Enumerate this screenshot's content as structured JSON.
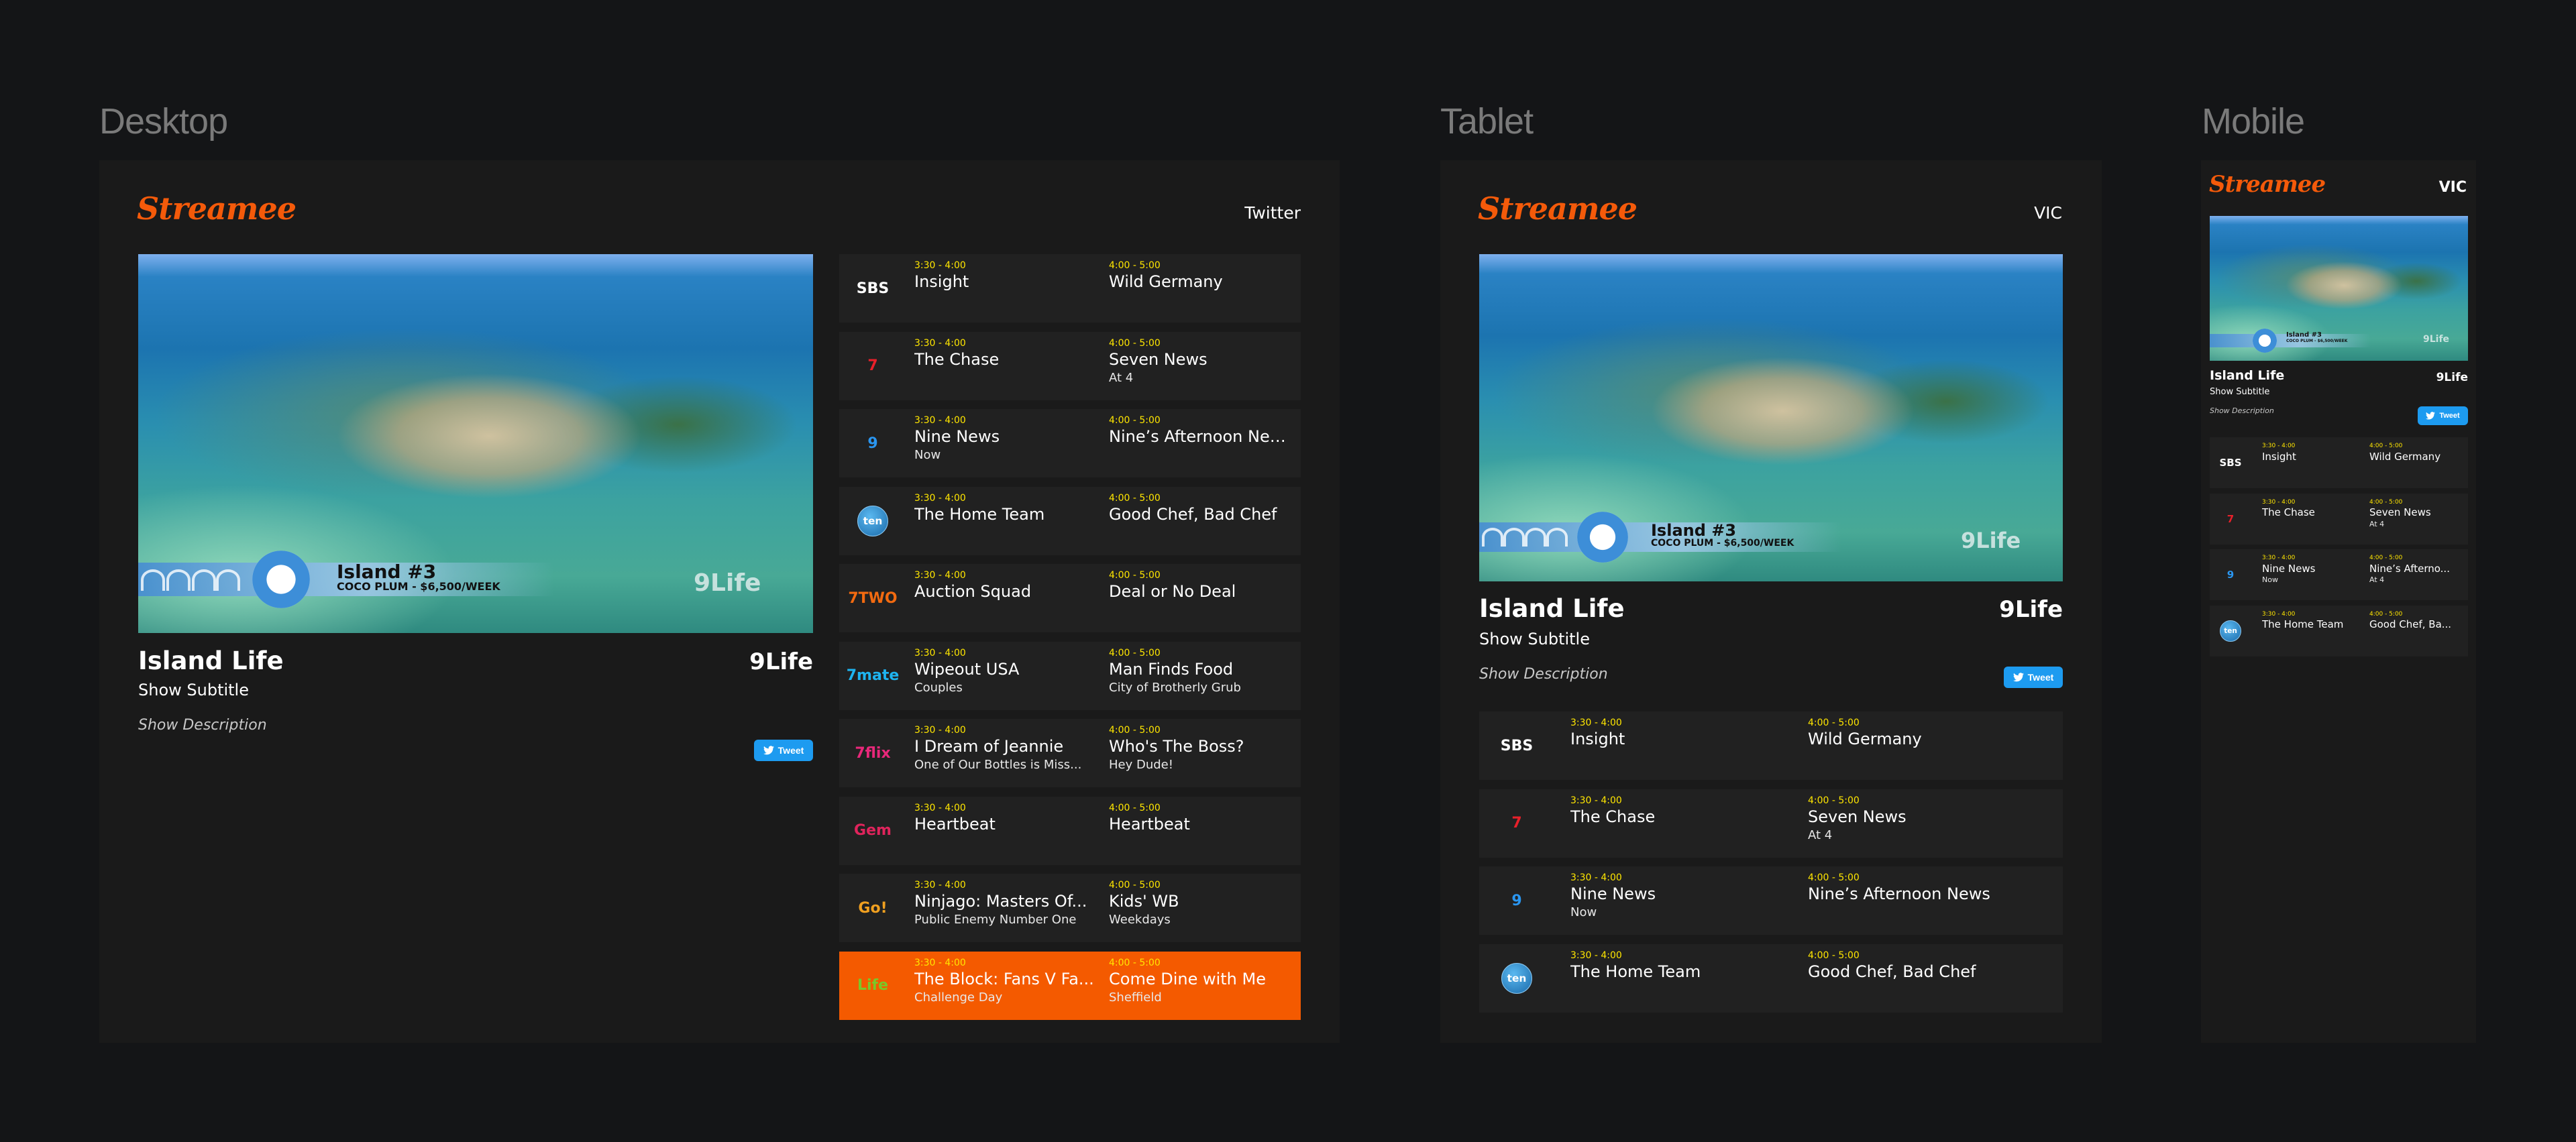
{
  "labels": {
    "desktop": "Desktop",
    "tablet": "Tablet",
    "mobile": "Mobile"
  },
  "brand": {
    "name": "Streamee",
    "accent": "#f45a0a"
  },
  "desktop": {
    "region": "Twitter"
  },
  "tablet": {
    "region": "VIC"
  },
  "mobile": {
    "region": "VIC"
  },
  "show": {
    "title": "Island Life",
    "subtitle": "Show Subtitle",
    "description": "Show Description",
    "channel_logo": "9Life",
    "tweet_label": "Tweet",
    "video_overlay": {
      "title": "Island #3",
      "subtitle": "COCO PLUM - $6,500/WEEK",
      "watermark": "9Life"
    }
  },
  "time_slots": {
    "now": "3:30 - 4:00",
    "next": "4:00 - 5:00"
  },
  "channels": [
    {
      "logo": "SBS",
      "icon": "sbs-logo-icon",
      "color": "#ffffff",
      "now": {
        "title": "Insight",
        "episode": ""
      },
      "next": {
        "title": "Wild Germany",
        "episode": ""
      }
    },
    {
      "logo": "7",
      "icon": "seven-logo-icon",
      "color": "#e8202a",
      "now": {
        "title": "The Chase",
        "episode": ""
      },
      "next": {
        "title": "Seven News",
        "episode": "At 4"
      }
    },
    {
      "logo": "9",
      "icon": "nine-logo-icon",
      "color": "#2a96f0",
      "now": {
        "title": "Nine News",
        "episode": "Now"
      },
      "next": {
        "title": "Nine’s Afternoon News",
        "episode": ""
      }
    },
    {
      "logo": "ten",
      "icon": "ten-logo-icon",
      "color": "#2a86c8",
      "now": {
        "title": "The Home Team",
        "episode": ""
      },
      "next": {
        "title": "Good Chef, Bad Chef",
        "episode": ""
      }
    },
    {
      "logo": "7TWO",
      "icon": "seven-two-logo-icon",
      "color": "#f26a10",
      "now": {
        "title": "Auction Squad",
        "episode": ""
      },
      "next": {
        "title": "Deal or No Deal",
        "episode": ""
      }
    },
    {
      "logo": "7mate",
      "icon": "seven-mate-logo-icon",
      "color": "#1eb4f0",
      "now": {
        "title": "Wipeout USA",
        "episode": "Couples"
      },
      "next": {
        "title": "Man Finds Food",
        "episode": "City of Brotherly Grub"
      }
    },
    {
      "logo": "7flix",
      "icon": "seven-flix-logo-icon",
      "color": "#e8287a",
      "now": {
        "title": "I Dream of Jeannie",
        "episode": "One of Our Bottles is Miss..."
      },
      "next": {
        "title": "Who's The Boss?",
        "episode": "Hey Dude!"
      }
    },
    {
      "logo": "Gem",
      "icon": "gem-logo-icon",
      "color": "#e0245c",
      "now": {
        "title": "Heartbeat",
        "episode": ""
      },
      "next": {
        "title": "Heartbeat",
        "episode": ""
      }
    },
    {
      "logo": "Go!",
      "icon": "go-logo-icon",
      "color": "#f0a020",
      "now": {
        "title": "Ninjago: Masters Of...",
        "episode": "Public Enemy Number One"
      },
      "next": {
        "title": "Kids' WB",
        "episode": "Weekdays"
      }
    },
    {
      "logo": "Life",
      "icon": "life-logo-icon",
      "color": "#7ac828",
      "active": true,
      "now": {
        "title": "The Block: Fans V Fa...",
        "episode": "Challenge Day"
      },
      "next": {
        "title": "Come Dine with Me",
        "episode": "Sheffield"
      }
    }
  ],
  "mobile_channels": [
    {
      "logo": "SBS",
      "now": {
        "title": "Insight",
        "episode": ""
      },
      "next": {
        "title": "Wild Germany",
        "episode": ""
      }
    },
    {
      "logo": "7",
      "now": {
        "title": "The Chase",
        "episode": ""
      },
      "next": {
        "title": "Seven News",
        "episode": "At 4"
      }
    },
    {
      "logo": "9",
      "now": {
        "title": "Nine News",
        "episode": "Now"
      },
      "next": {
        "title": "Nine’s Afterno...",
        "episode": "At 4"
      }
    },
    {
      "logo": "ten",
      "now": {
        "title": "The Home Team",
        "episode": ""
      },
      "next": {
        "title": "Good Chef, Ba...",
        "episode": ""
      }
    }
  ]
}
